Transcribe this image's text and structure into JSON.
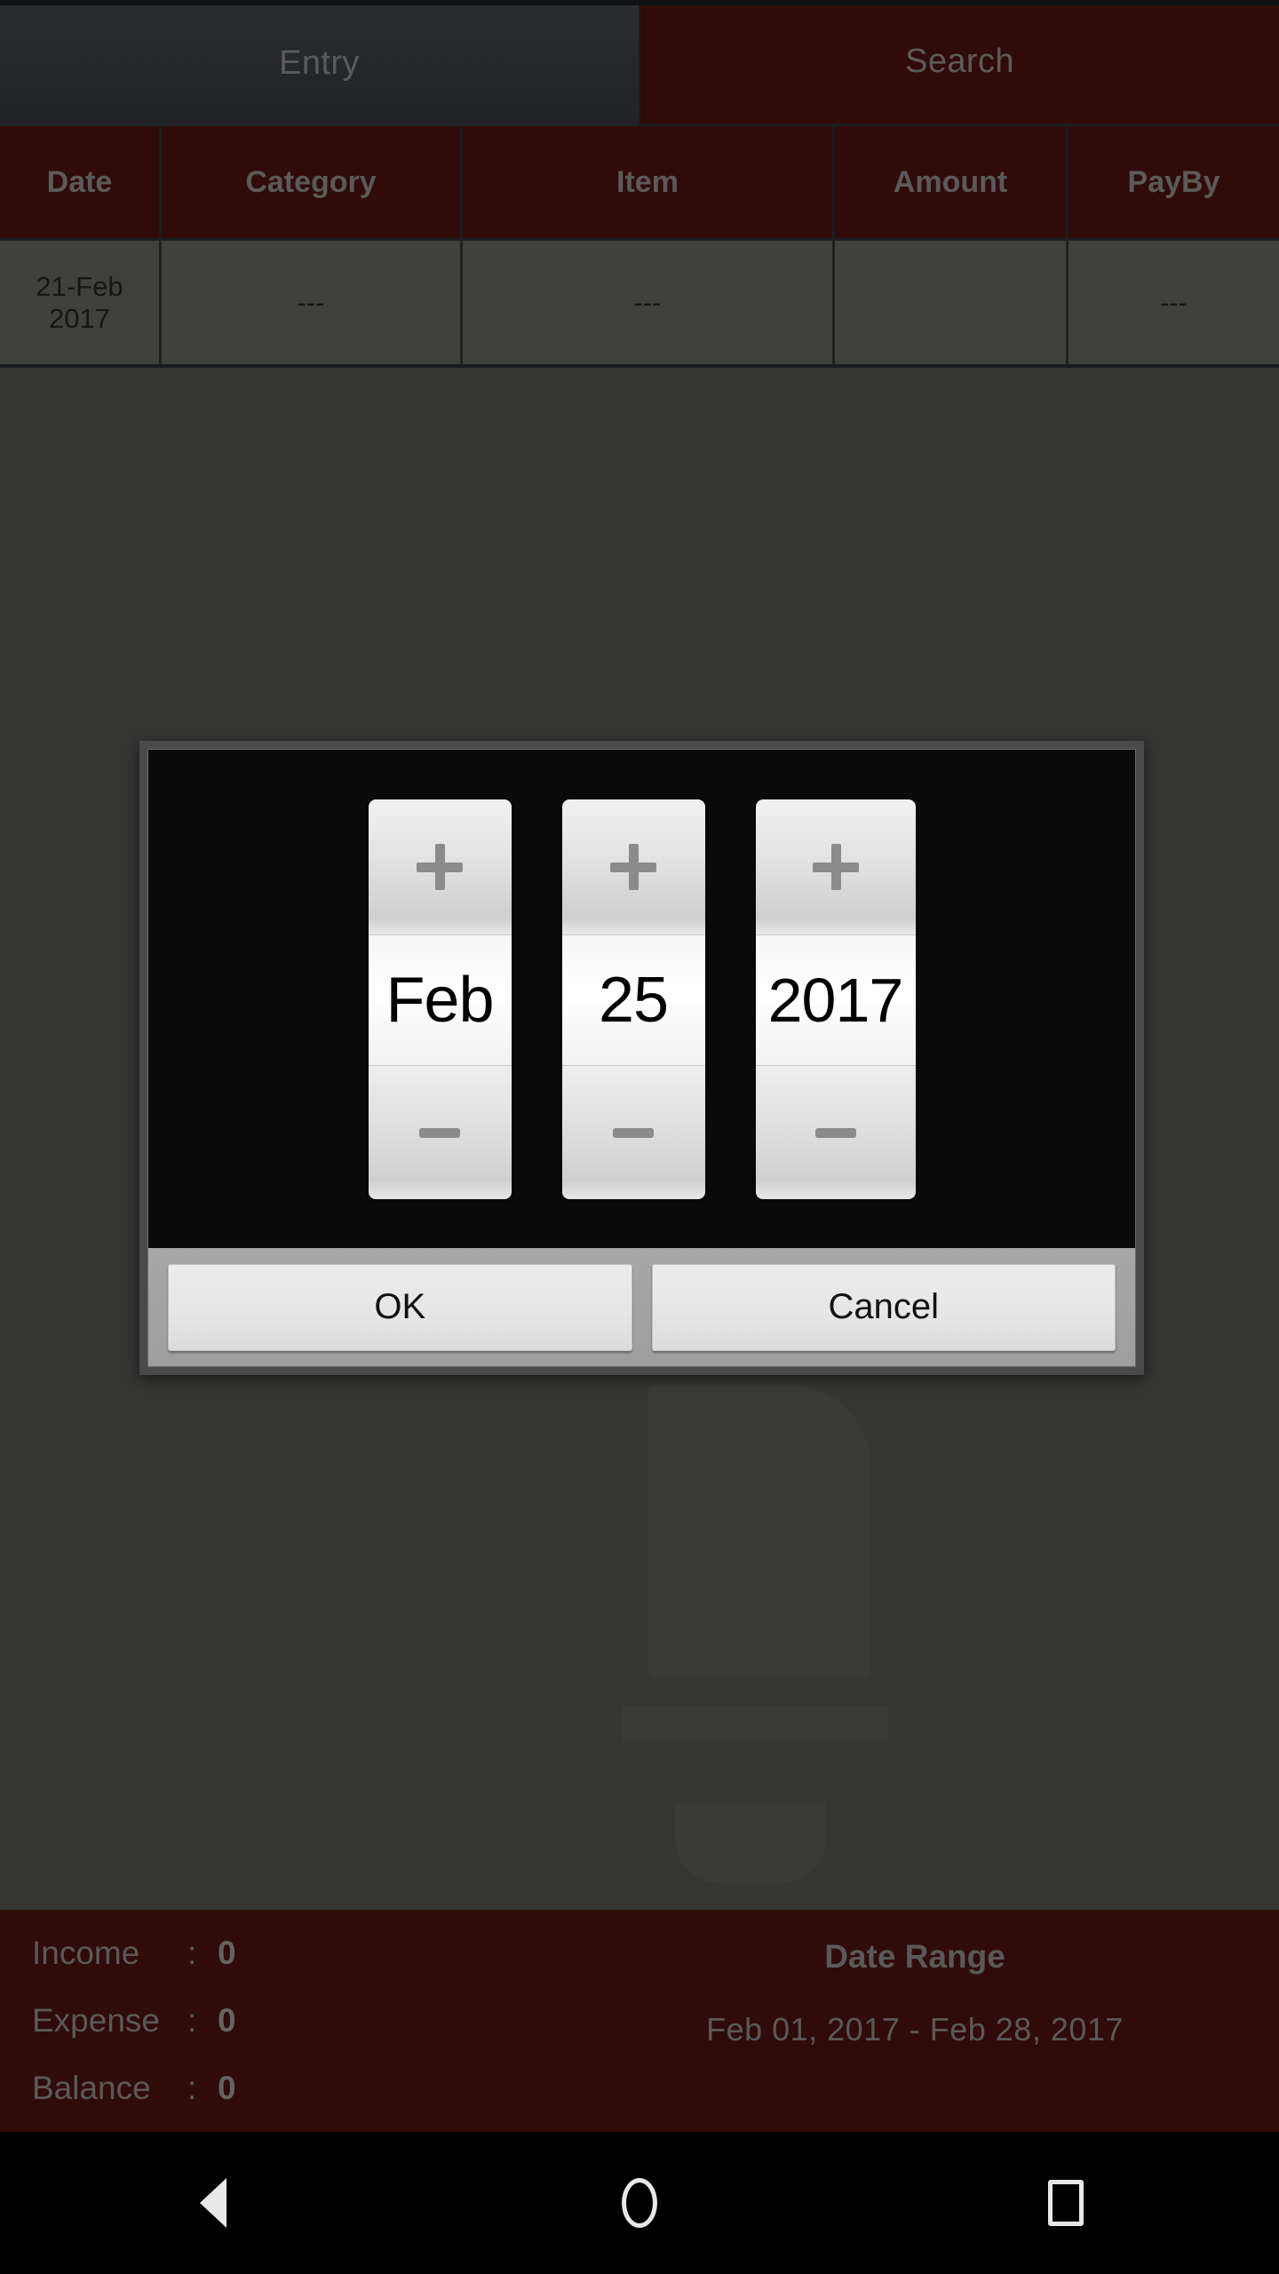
{
  "tabs": [
    {
      "label": "Entry",
      "state": "selected"
    },
    {
      "label": "Search",
      "state": "unselected"
    }
  ],
  "table": {
    "columns": [
      "Date",
      "Category",
      "Item",
      "Amount",
      "PayBy"
    ],
    "rows": [
      {
        "date": "21-Feb\n2017",
        "category": "---",
        "item": "---",
        "amount": "",
        "payby": "---"
      }
    ]
  },
  "summary": {
    "income_label": "Income",
    "income_colon": ":",
    "income_value": "0",
    "expense_label": "Expense",
    "expense_colon": ":",
    "expense_value": "0",
    "balance_label": "Balance",
    "balance_colon": ":",
    "balance_value": "0",
    "range_title": "Date Range",
    "range_value": "Feb 01, 2017  -  Feb 28, 2017"
  },
  "date_picker": {
    "month": "Feb",
    "day": "25",
    "year": "2017",
    "increment_icon": "plus-icon",
    "decrement_icon": "minus-icon",
    "ok_label": "OK",
    "cancel_label": "Cancel"
  },
  "navbar": {
    "back_icon": "back-triangle-icon",
    "home_icon": "home-circle-icon",
    "recents_icon": "recents-square-icon"
  },
  "colors": {
    "brand_red": "#551310",
    "tab_selected": "#424749",
    "table_row": "#6e6e68",
    "dialog_black": "#0a0a0a",
    "text_muted": "#9a9a9a"
  }
}
